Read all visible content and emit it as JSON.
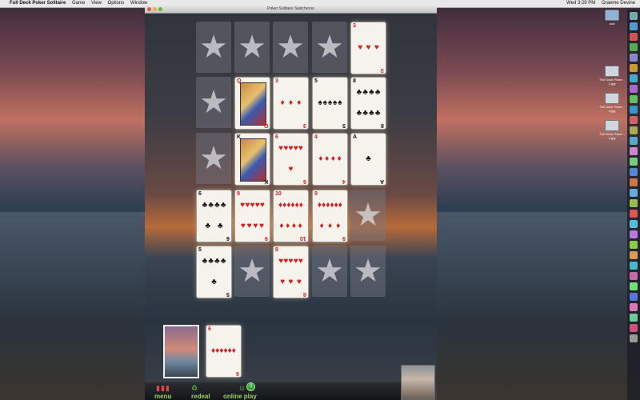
{
  "menubar": {
    "app_name": "Full Deck Poker Solitaire",
    "menus": [
      "Game",
      "View",
      "Options",
      "Window"
    ],
    "clock": "Wed 3:29 PM",
    "user": "Graeme Devine"
  },
  "window": {
    "title": "Poker Solitaire Switcheroo"
  },
  "board": {
    "star_glyph": "★",
    "row1": [
      {
        "kind": "star"
      },
      {
        "kind": "star"
      },
      {
        "kind": "star"
      },
      {
        "kind": "star"
      },
      {
        "kind": "card",
        "rank": "3",
        "suit": "♥",
        "color": "red"
      }
    ],
    "row2": [
      {
        "kind": "star"
      },
      {
        "kind": "card",
        "rank": "Q",
        "suit": "♦",
        "color": "red",
        "face": true
      },
      {
        "kind": "card",
        "rank": "3",
        "suit": "♦",
        "color": "red"
      },
      {
        "kind": "card",
        "rank": "5",
        "suit": "♠",
        "color": "blk"
      },
      {
        "kind": "card",
        "rank": "8",
        "suit": "♣",
        "color": "blk"
      }
    ],
    "row3": [
      {
        "kind": "star"
      },
      {
        "kind": "card",
        "rank": "K",
        "suit": "♣",
        "color": "blk",
        "face": true
      },
      {
        "kind": "card",
        "rank": "6",
        "suit": "♥",
        "color": "red"
      },
      {
        "kind": "card",
        "rank": "4",
        "suit": "♦",
        "color": "red"
      },
      {
        "kind": "card",
        "rank": "A",
        "suit": "♣",
        "color": "blk"
      }
    ],
    "row4": [
      {
        "kind": "card",
        "rank": "6",
        "suit": "♣",
        "color": "blk"
      },
      {
        "kind": "card",
        "rank": "9",
        "suit": "♥",
        "color": "red"
      },
      {
        "kind": "card",
        "rank": "10",
        "suit": "♦",
        "color": "red"
      },
      {
        "kind": "card",
        "rank": "9",
        "suit": "♦",
        "color": "red"
      },
      {
        "kind": "star"
      }
    ],
    "row5": [
      {
        "kind": "card",
        "rank": "5",
        "suit": "♣",
        "color": "blk"
      },
      {
        "kind": "star"
      },
      {
        "kind": "card",
        "rank": "8",
        "suit": "♥",
        "color": "red"
      },
      {
        "kind": "star"
      },
      {
        "kind": "star"
      }
    ]
  },
  "draw_card": {
    "rank": "6",
    "suit": "♦",
    "color": "red"
  },
  "bottombar": {
    "menu_label": "menu",
    "redeal_label": "redeal",
    "online_label": "online play",
    "online_badge": "0"
  },
  "desktop": {
    "folder_label": "and",
    "files": [
      "Full Deck Poker - 2.jpg",
      "Full Deck Poker - 3.jpg",
      "Full Deck Poker - 4.jpg"
    ]
  }
}
